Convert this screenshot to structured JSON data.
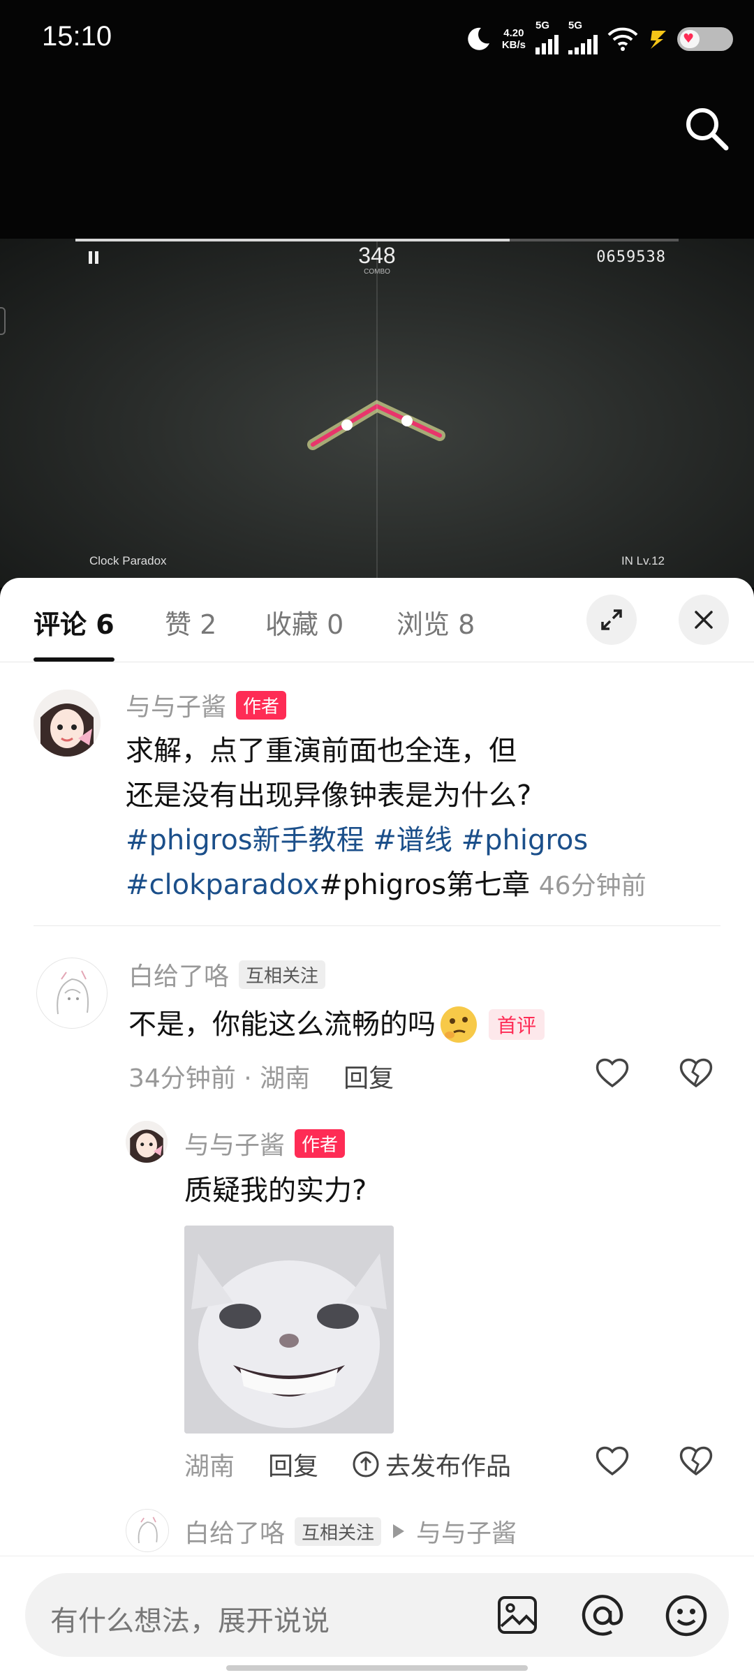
{
  "status_bar": {
    "time": "15:10",
    "net_speed": "4.20",
    "net_unit": "KB/s",
    "sim1": "5G",
    "sim2": "5G"
  },
  "video": {
    "combo": "348",
    "combo_label": "COMBO",
    "score": "0659538",
    "song_name": "Clock Paradox",
    "level": "IN  Lv.12",
    "progress": 0.72
  },
  "tabs": [
    {
      "label": "评论",
      "count": "6"
    },
    {
      "label": "赞",
      "count": "2"
    },
    {
      "label": "收藏",
      "count": "0"
    },
    {
      "label": "浏览",
      "count": "8"
    }
  ],
  "post": {
    "author": "与与子酱",
    "author_badge": "作者",
    "line1": "求解，点了重演前面也全连，但",
    "line2": "还是没有出现异像钟表是为什么?",
    "tag1": "#phigros新手教程",
    "tag2": "#谱线",
    "tag3": "#phigros",
    "tag4": "#clokparadox",
    "tag5_plain": "#phigros第七章",
    "time": "46分钟前"
  },
  "comment": {
    "user": "白给了咯",
    "badge": "互相关注",
    "text": "不是，你能这么流畅的吗",
    "first_badge": "首评",
    "time_loc": "34分钟前 · 湖南",
    "reply": "回复"
  },
  "reply": {
    "user": "与与子酱",
    "badge": "作者",
    "text": "质疑我的实力?",
    "loc": "湖南",
    "reply": "回复",
    "publish": "去发布作品"
  },
  "next_reply": {
    "user": "白给了咯",
    "badge": "互相关注",
    "target": "与与子酱"
  },
  "input": {
    "placeholder": "有什么想法，展开说说"
  },
  "colors": {
    "accent": "#fe2c55",
    "tag": "#1b4f8a"
  }
}
